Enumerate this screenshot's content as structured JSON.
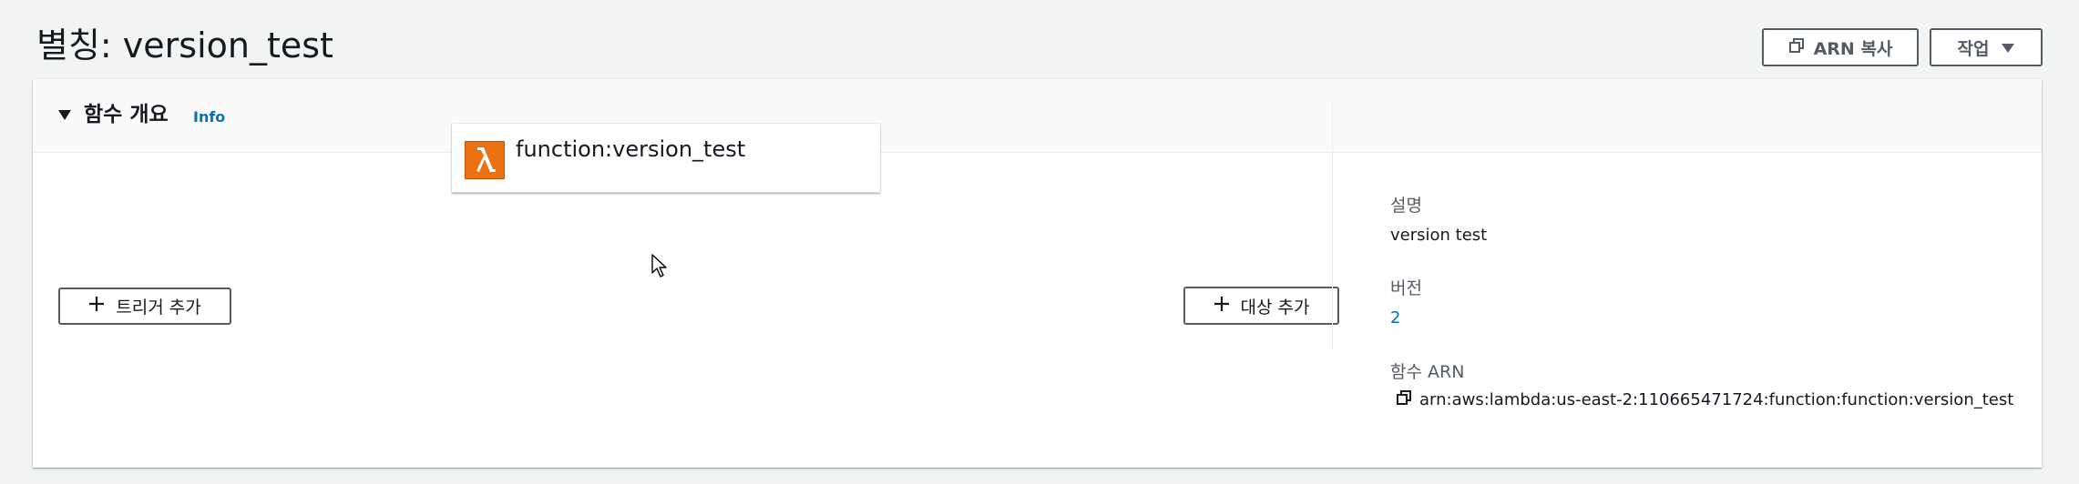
{
  "header": {
    "title": "별칭: version_test",
    "copy_arn_label": "ARN 복사",
    "actions_label": "작업"
  },
  "overview": {
    "title": "함수 개요",
    "info_label": "Info",
    "function_name": "function:version_test",
    "add_trigger_label": "트리거 추가",
    "add_destination_label": "대상 추가"
  },
  "details": {
    "description_label": "설명",
    "description_value": "version test",
    "version_label": "버전",
    "version_value": "2",
    "arn_label": "함수 ARN",
    "arn_value": "arn:aws:lambda:us-east-2:110665471724:function:function:version_test"
  },
  "icons": {
    "copy": "copy-icon",
    "caret": "caret-down-icon",
    "plus": "plus-icon",
    "lambda": "lambda-icon",
    "cursor": "mouse-cursor-icon"
  },
  "colors": {
    "link": "#0073bb",
    "lambda_orange": "#ec7211",
    "background": "#f2f3f3"
  }
}
